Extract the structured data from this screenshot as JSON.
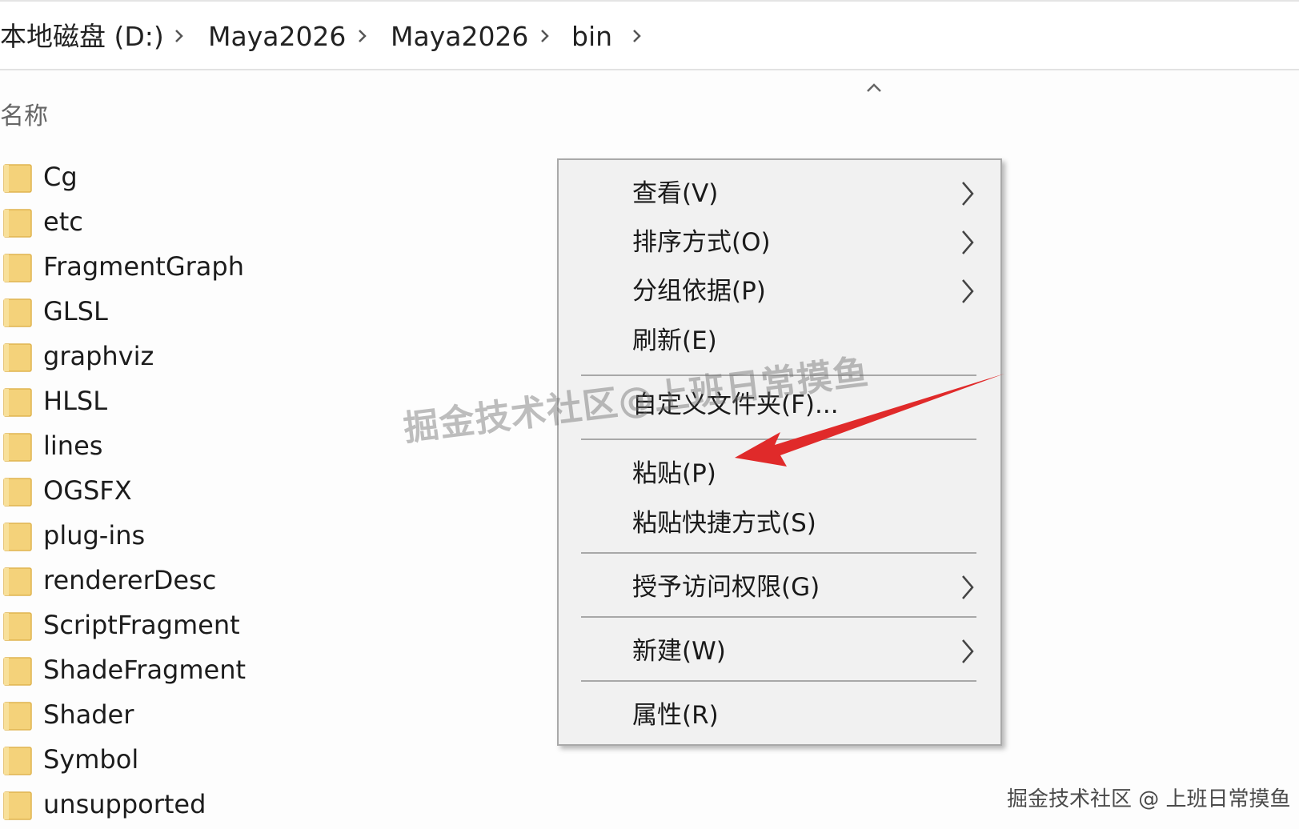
{
  "breadcrumb": {
    "items": [
      "本地磁盘 (D:)",
      "Maya2026",
      "Maya2026",
      "bin"
    ]
  },
  "header": {
    "name_column": "名称"
  },
  "files": [
    "Cg",
    "etc",
    "FragmentGraph",
    "GLSL",
    "graphviz",
    "HLSL",
    "lines",
    "OGSFX",
    "plug-ins",
    "rendererDesc",
    "ScriptFragment",
    "ShadeFragment",
    "Shader",
    "Symbol",
    "unsupported"
  ],
  "context_menu": {
    "view": "查看(V)",
    "sort_by": "排序方式(O)",
    "group_by": "分组依据(P)",
    "refresh": "刷新(E)",
    "customize_folder": "自定义文件夹(F)...",
    "paste": "粘贴(P)",
    "paste_shortcut": "粘贴快捷方式(S)",
    "give_access": "授予访问权限(G)",
    "new": "新建(W)",
    "properties": "属性(R)"
  },
  "watermark": {
    "center": "掘金技术社区@上班日常摸鱼",
    "corner": "掘金技术社区 @ 上班日常摸鱼"
  },
  "colors": {
    "folder": "#f4d27a",
    "arrow": "#e02a2a",
    "menu_bg": "#f1f1f1"
  }
}
